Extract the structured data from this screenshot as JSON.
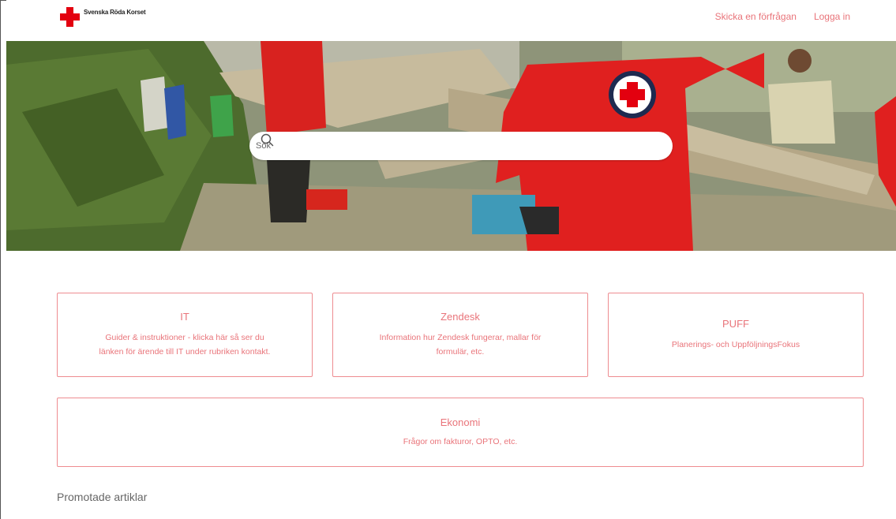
{
  "header": {
    "logo_text": "Svenska Röda Korset",
    "nav": [
      "Skicka en förfrågan",
      "Logga in"
    ]
  },
  "hero": {
    "search_placeholder": "Sök"
  },
  "categories": [
    {
      "title": "IT",
      "desc1": "Guider & instruktioner - klicka här så ser du",
      "desc2": "länken för ärende till IT under rubriken kontakt."
    },
    {
      "title": "Zendesk",
      "desc1": "Information hur Zendesk fungerar, mallar för",
      "desc2": "formulär, etc."
    },
    {
      "title": "PUFF",
      "desc1": "Planerings- och UppföljningsFokus",
      "desc2": ""
    },
    {
      "title": "Ekonomi",
      "desc1": "Frågor om fakturor, OPTO, etc.",
      "desc2": ""
    }
  ],
  "promoted_title": "Promotade artiklar",
  "colors": {
    "brand": "#e3000f",
    "accent": "#e9747a",
    "border": "#ee8c90"
  }
}
